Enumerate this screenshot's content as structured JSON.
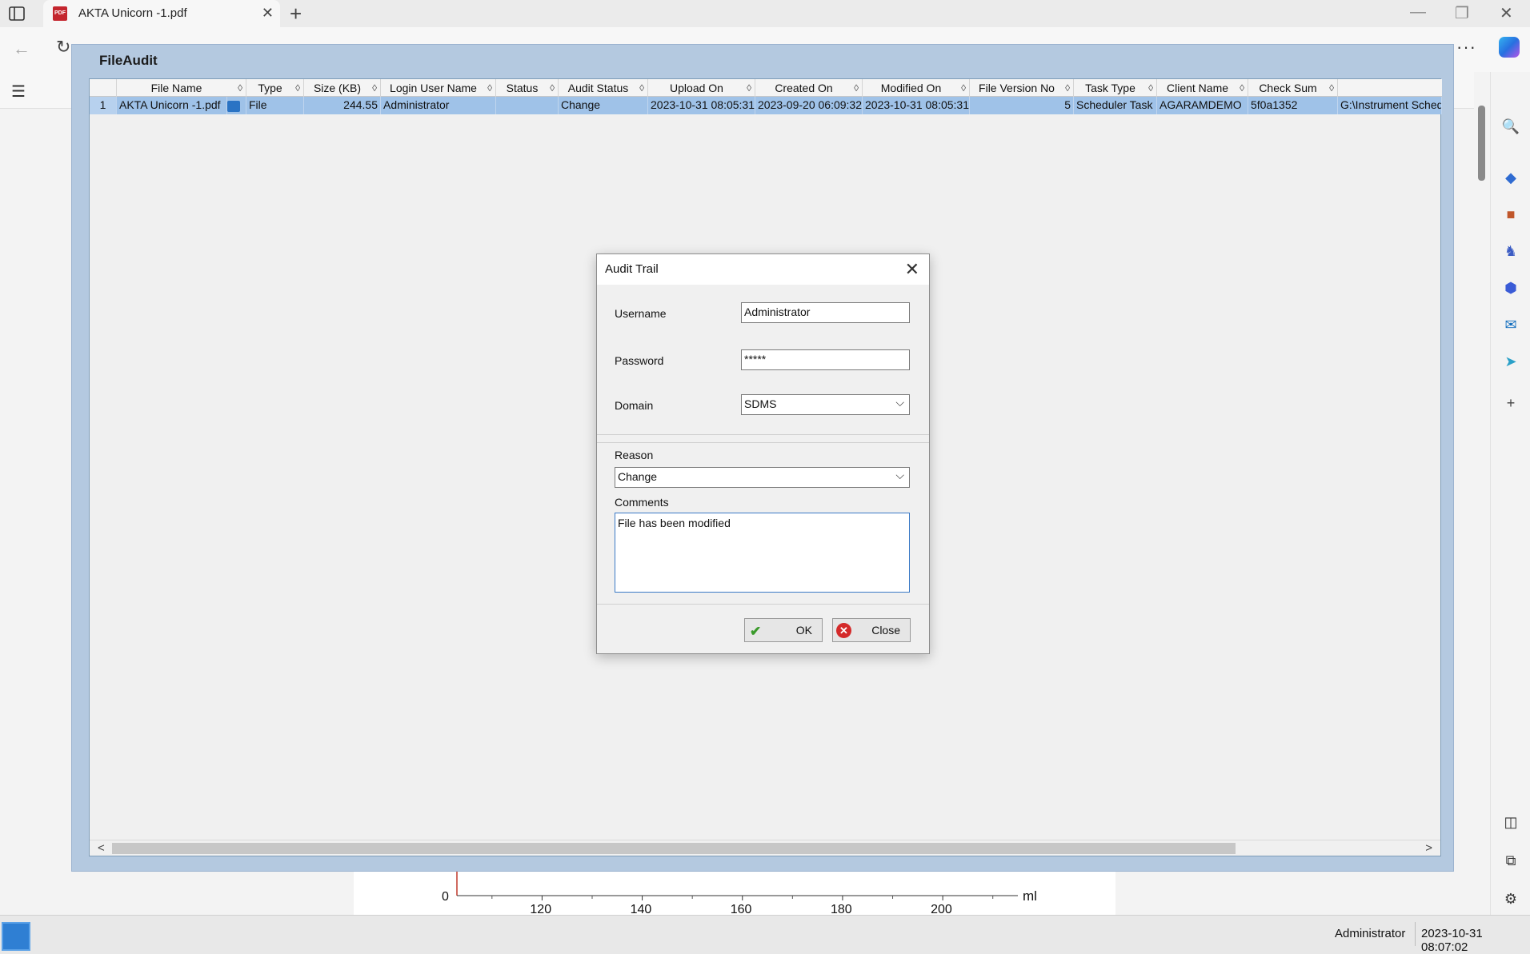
{
  "browser": {
    "tab_title": "AKTA Unicorn -1.pdf",
    "tab_icon_label": "PDF",
    "new_tab_glyph": "+",
    "close_glyph": "✕",
    "minimize_glyph": "—",
    "restore_glyph": "❐",
    "more_glyph": "···",
    "back_glyph": "←",
    "refresh_glyph": "↻",
    "contents_glyph": "☰"
  },
  "sidebar_icons": [
    {
      "name": "search-icon",
      "glyph": "🔍",
      "color": "#333333"
    },
    {
      "name": "tag-icon",
      "glyph": "◆",
      "color": "#2f6bd1"
    },
    {
      "name": "briefcase-icon",
      "glyph": "■",
      "color": "#c0562a"
    },
    {
      "name": "chess-icon",
      "glyph": "♞",
      "color": "#3b5cc4"
    },
    {
      "name": "m365-icon",
      "glyph": "⬢",
      "color": "#3a5bd6"
    },
    {
      "name": "outlook-icon",
      "glyph": "✉",
      "color": "#0f6cbd"
    },
    {
      "name": "send-icon",
      "glyph": "➤",
      "color": "#2aa0c8"
    },
    {
      "name": "add-icon",
      "glyph": "+",
      "color": "#444444"
    },
    {
      "name": "split-screen-icon",
      "glyph": "◫",
      "color": "#333333"
    },
    {
      "name": "external-link-icon",
      "glyph": "⧉",
      "color": "#333333"
    },
    {
      "name": "settings-icon",
      "glyph": "⚙",
      "color": "#333333"
    }
  ],
  "fileaudit": {
    "title": "FileAudit",
    "columns": [
      "File Name",
      "Type",
      "Size (KB)",
      "Login User Name",
      "Status",
      "Audit Status",
      "Upload On",
      "Created On",
      "Modified On",
      "File Version No",
      "Task Type",
      "Client Name",
      "Check Sum"
    ],
    "sort_glyph": "◊",
    "row": {
      "row_number": "1",
      "file_name": "AKTA Unicorn -1.pdf",
      "type": "File",
      "size_kb": "244.55",
      "login_user": "Administrator",
      "status": "",
      "audit_status": "Change",
      "upload_on": "2023-10-31 08:05:31",
      "created_on": "2023-09-20 06:09:32",
      "modified_on": "2023-10-31 08:05:31",
      "file_version": "5",
      "task_type": "Scheduler Task",
      "client_name": "AGARAMDEMO",
      "check_sum": "5f0a1352",
      "path": "G:\\Instrument Scheduler"
    },
    "scroll_left": "<",
    "scroll_right": ">"
  },
  "dialog": {
    "title": "Audit Trail",
    "close_glyph": "✕",
    "username_label": "Username",
    "username_value": "Administrator",
    "password_label": "Password",
    "password_value": "*****",
    "domain_label": "Domain",
    "domain_value": "SDMS",
    "reason_label": "Reason",
    "reason_value": "Change",
    "comments_label": "Comments",
    "comments_value": "File  has been modified",
    "ok_label": "OK",
    "close_label": "Close",
    "chevron_glyph": "⌵"
  },
  "pdf_chart": {
    "y_tick": "0",
    "x_ticks": [
      "120",
      "140",
      "160",
      "180",
      "200"
    ],
    "unit": "ml"
  },
  "statusbar": {
    "user": "Administrator",
    "datetime": "2023-10-31 08:07:02"
  }
}
